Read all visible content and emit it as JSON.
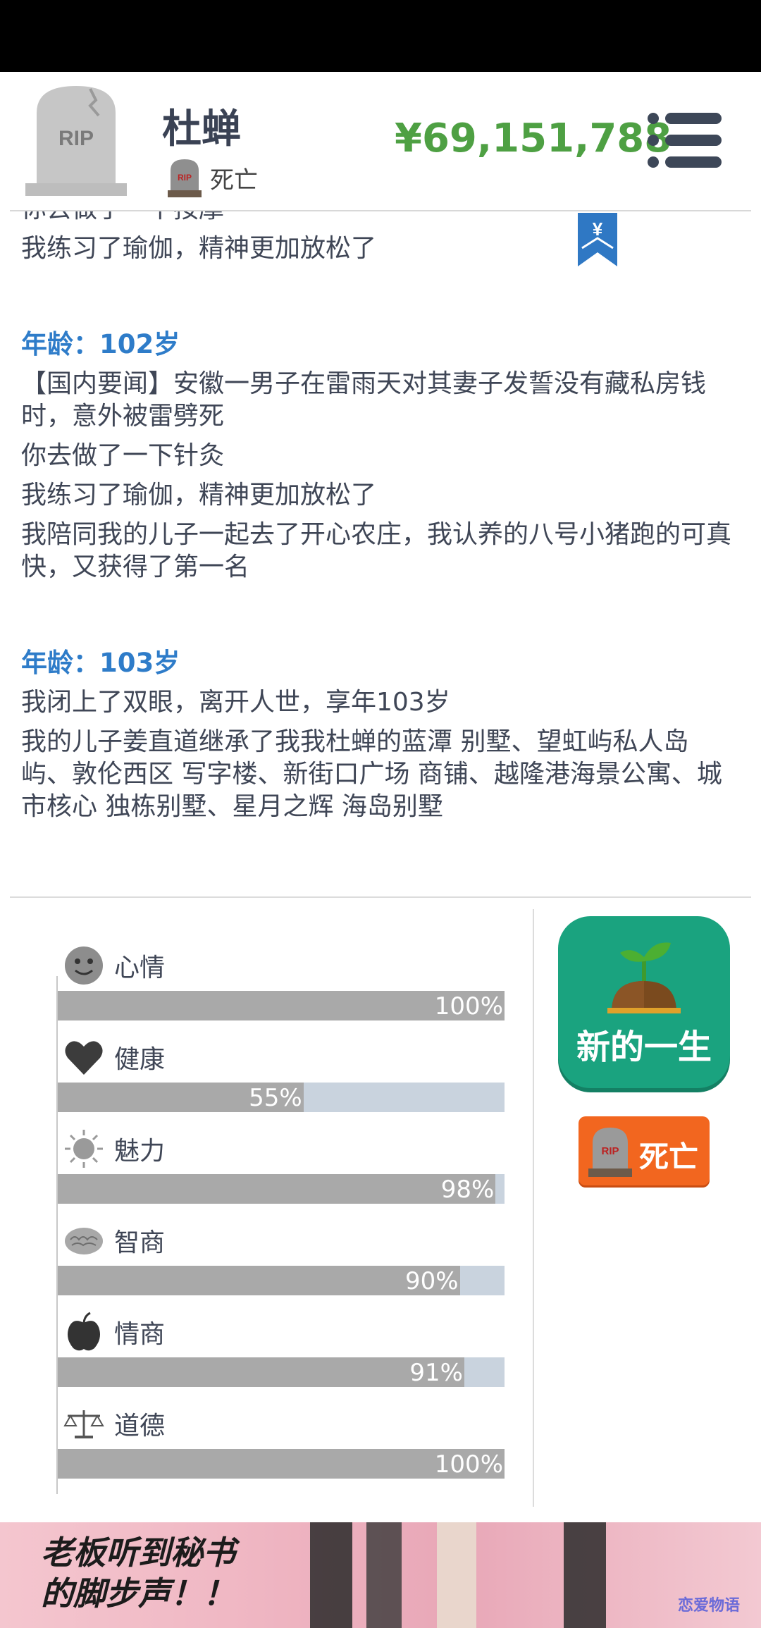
{
  "header": {
    "name": "杜蝉",
    "status": "死亡",
    "money": "¥69,151,788",
    "tomb_text": "RIP"
  },
  "log": {
    "partial_top": "你去做了一下按摩",
    "lines_before": [
      "我练习了瑜伽，精神更加放松了"
    ],
    "entries": [
      {
        "age": "年龄：102岁",
        "lines": [
          "【国内要闻】安徽一男子在雷雨天对其妻子发誓没有藏私房钱时，意外被雷劈死",
          "你去做了一下针灸",
          "我练习了瑜伽，精神更加放松了",
          "我陪同我的儿子一起去了开心农庄，我认养的八号小猪跑的可真快，又获得了第一名"
        ]
      },
      {
        "age": "年龄：103岁",
        "lines": [
          "我闭上了双眼，离开人世，享年103岁",
          "我的儿子姜直道继承了我我杜蝉的蓝潭 别墅、望虹屿私人岛屿、敦伦西区 写字楼、新街口广场 商铺、越隆港海景公寓、城市核心 独栋别墅、星月之辉 海岛别墅"
        ]
      }
    ]
  },
  "stats": [
    {
      "label": "心情",
      "icon": "smiley-face-icon",
      "value": 1.0,
      "text": "100%"
    },
    {
      "label": "健康",
      "icon": "heart-icon",
      "value": 0.55,
      "text": "55%"
    },
    {
      "label": "魅力",
      "icon": "sun-icon",
      "value": 0.98,
      "text": "98%"
    },
    {
      "label": "智商",
      "icon": "brain-icon",
      "value": 0.9,
      "text": "90%"
    },
    {
      "label": "情商",
      "icon": "apple-icon",
      "value": 0.91,
      "text": "91%"
    },
    {
      "label": "道德",
      "icon": "scales-icon",
      "value": 1.0,
      "text": "100%"
    }
  ],
  "buttons": {
    "new_life": "新的一生",
    "dead": "死亡"
  },
  "ad": {
    "text_line1": "老板听到秘书",
    "text_line2": "的脚步声！！",
    "watermark": "恋爱物语"
  },
  "colors": {
    "money": "#4ea043",
    "age": "#2e7cc9",
    "new_life": "#1aa37f",
    "dead": "#f2661f",
    "bar_fill": "#a9a9a9",
    "bar_track": "#c9d3de"
  }
}
